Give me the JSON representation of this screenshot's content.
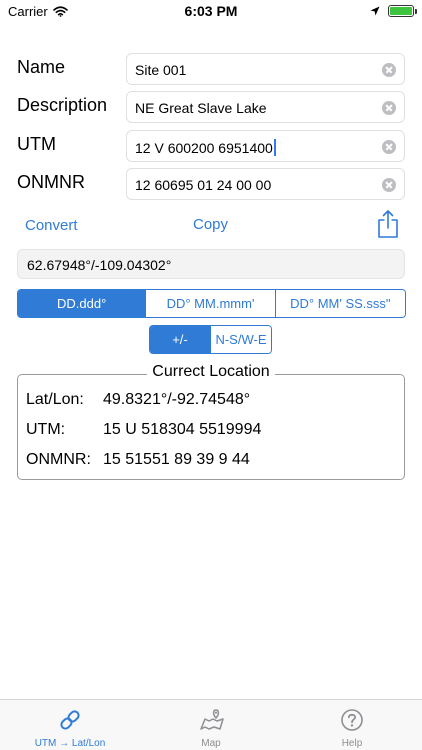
{
  "status_bar": {
    "carrier": "Carrier",
    "time": "6:03 PM",
    "battery_level": 1.0
  },
  "form": {
    "name": {
      "label": "Name",
      "value": "Site 001"
    },
    "description": {
      "label": "Description",
      "value": "NE Great Slave Lake"
    },
    "utm": {
      "label": "UTM",
      "value": "12 V 600200 6951400"
    },
    "onmnr": {
      "label": "ONMNR",
      "value": "12 60695 01 24 00 00"
    }
  },
  "actions": {
    "convert_label": "Convert",
    "copy_label": "Copy"
  },
  "result": "62.67948°/-109.04302°",
  "format_options": {
    "items": [
      "DD.ddd°",
      "DD° MM.mmm'",
      "DD° MM' SS.sss\""
    ],
    "selected": "DD.ddd°"
  },
  "sign_options": {
    "items": [
      "+/-",
      "N-S/W-E"
    ],
    "selected": "+/-"
  },
  "current_location": {
    "title": "Currect Location",
    "latlon_label": "Lat/Lon:",
    "latlon_value": "49.8321°/-92.74548°",
    "utm_label": "UTM:",
    "utm_value": "15 U 518304 5519994",
    "onmnr_label": "ONMNR:",
    "onmnr_value": "15 51551 89 39 9 44"
  },
  "tabs": [
    {
      "label": "UTM → Lat/Lon",
      "icon": "link-icon",
      "active": true
    },
    {
      "label": "Map",
      "icon": "map-icon",
      "active": false
    },
    {
      "label": "Help",
      "icon": "help-icon",
      "active": false
    }
  ],
  "colors": {
    "accent": "#2f7bd6",
    "battery": "#3ec43e",
    "inactive_tab": "#8e8e93"
  }
}
